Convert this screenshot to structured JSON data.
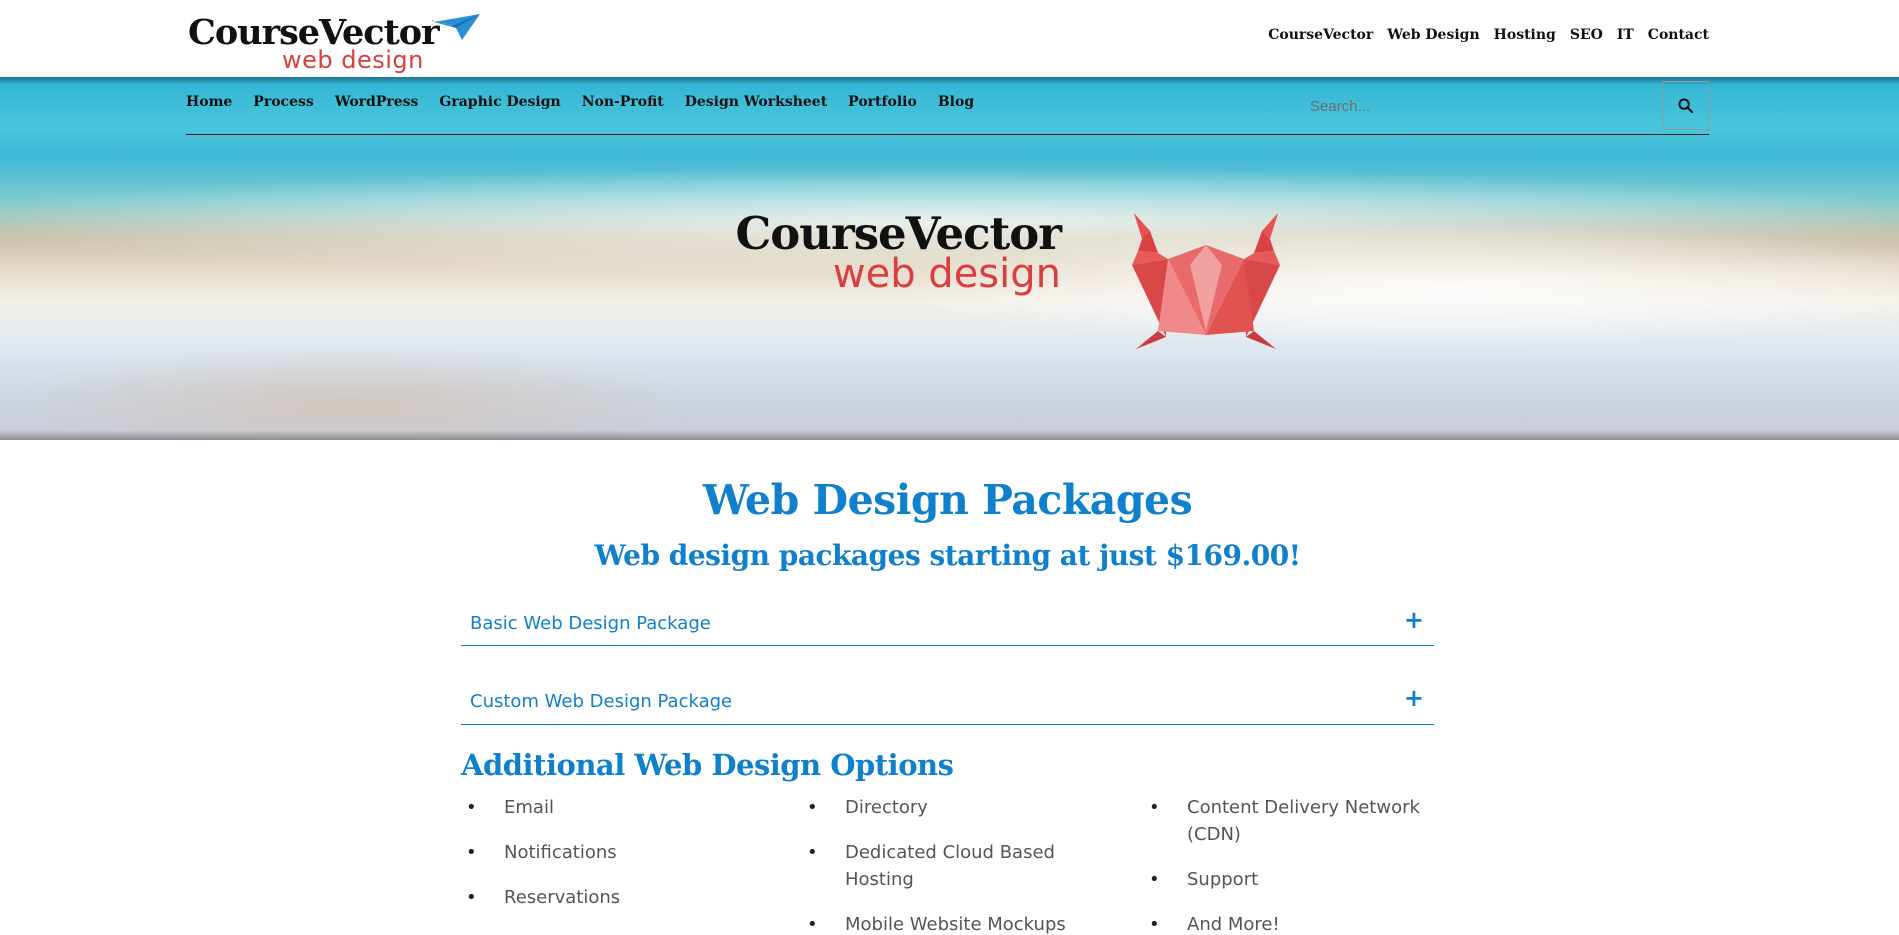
{
  "header": {
    "logo_main": "CourseVector",
    "logo_sub": "web design",
    "top_nav": [
      "CourseVector",
      "Web Design",
      "Hosting",
      "SEO",
      "IT",
      "Contact"
    ]
  },
  "main_nav": {
    "items": [
      "Home",
      "Process",
      "WordPress",
      "Graphic Design",
      "Non-Profit",
      "Design Worksheet",
      "Portfolio",
      "Blog"
    ],
    "search_placeholder": "Search...",
    "search_icon": "search-icon"
  },
  "hero": {
    "logo_main": "CourseVector",
    "logo_sub": "web design",
    "mascot": "crab-icon"
  },
  "content": {
    "title": "Web Design Packages",
    "subtitle": "Web design packages starting at just $169.00!",
    "accordions": [
      {
        "label": "Basic Web Design Package",
        "icon": "+"
      },
      {
        "label": "Custom Web Design Package",
        "icon": "+"
      }
    ],
    "options_title": "Additional Web Design Options",
    "options_columns": [
      [
        "Email",
        "Notifications",
        "Reservations"
      ],
      [
        "Directory",
        "Dedicated Cloud Based Hosting",
        "Mobile Website Mockups"
      ],
      [
        "Content Delivery Network (CDN)",
        "Support",
        "And More!"
      ]
    ]
  },
  "colors": {
    "accent_blue": "#0f80cc",
    "logo_red": "#d93f3f",
    "crab_red": "#e8504f"
  }
}
